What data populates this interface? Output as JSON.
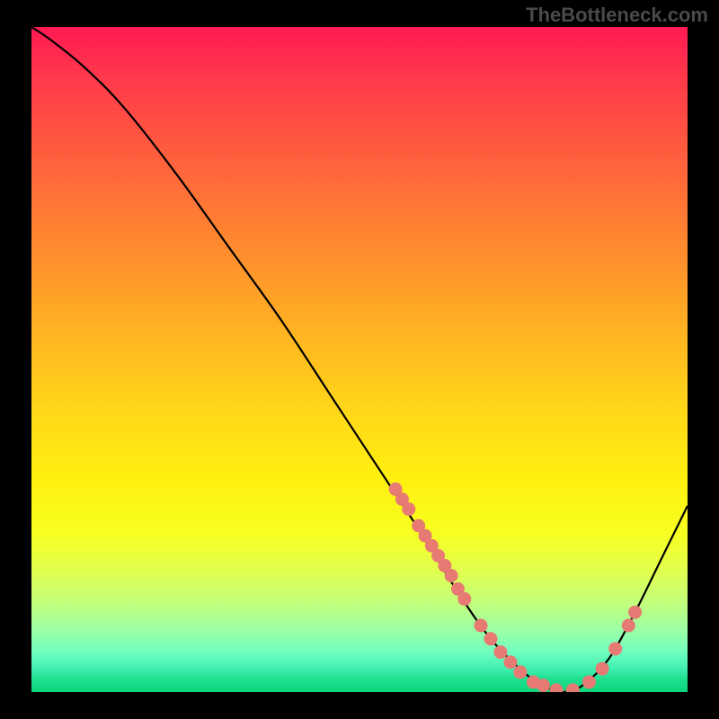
{
  "watermark": "TheBottleneck.com",
  "chart_data": {
    "type": "line",
    "title": "",
    "xlabel": "",
    "ylabel": "",
    "xlim": [
      0,
      100
    ],
    "ylim": [
      0,
      100
    ],
    "curve": [
      {
        "x": 0,
        "y": 100
      },
      {
        "x": 3,
        "y": 98
      },
      {
        "x": 8,
        "y": 94
      },
      {
        "x": 14,
        "y": 88
      },
      {
        "x": 22,
        "y": 78
      },
      {
        "x": 30,
        "y": 67
      },
      {
        "x": 38,
        "y": 56
      },
      {
        "x": 46,
        "y": 44
      },
      {
        "x": 54,
        "y": 32
      },
      {
        "x": 60,
        "y": 23
      },
      {
        "x": 65,
        "y": 15
      },
      {
        "x": 70,
        "y": 8
      },
      {
        "x": 75,
        "y": 3
      },
      {
        "x": 78,
        "y": 1
      },
      {
        "x": 81,
        "y": 0
      },
      {
        "x": 84,
        "y": 1
      },
      {
        "x": 88,
        "y": 5
      },
      {
        "x": 92,
        "y": 12
      },
      {
        "x": 96,
        "y": 20
      },
      {
        "x": 100,
        "y": 28
      }
    ],
    "markers": [
      {
        "x": 55.5,
        "y": 30.5
      },
      {
        "x": 56.5,
        "y": 29
      },
      {
        "x": 57.5,
        "y": 27.5
      },
      {
        "x": 59.0,
        "y": 25
      },
      {
        "x": 60.0,
        "y": 23.5
      },
      {
        "x": 61.0,
        "y": 22
      },
      {
        "x": 62.0,
        "y": 20.5
      },
      {
        "x": 63.0,
        "y": 19
      },
      {
        "x": 64.0,
        "y": 17.5
      },
      {
        "x": 65.0,
        "y": 15.5
      },
      {
        "x": 66.0,
        "y": 14
      },
      {
        "x": 68.5,
        "y": 10
      },
      {
        "x": 70.0,
        "y": 8
      },
      {
        "x": 71.5,
        "y": 6
      },
      {
        "x": 73.0,
        "y": 4.5
      },
      {
        "x": 74.5,
        "y": 3
      },
      {
        "x": 76.5,
        "y": 1.5
      },
      {
        "x": 78.0,
        "y": 1
      },
      {
        "x": 80.0,
        "y": 0.3
      },
      {
        "x": 82.5,
        "y": 0.3
      },
      {
        "x": 85.0,
        "y": 1.5
      },
      {
        "x": 87.0,
        "y": 3.5
      },
      {
        "x": 89.0,
        "y": 6.5
      },
      {
        "x": 91.0,
        "y": 10
      },
      {
        "x": 92.0,
        "y": 12
      }
    ],
    "marker_color": "#e77a72",
    "curve_color": "#000000"
  }
}
